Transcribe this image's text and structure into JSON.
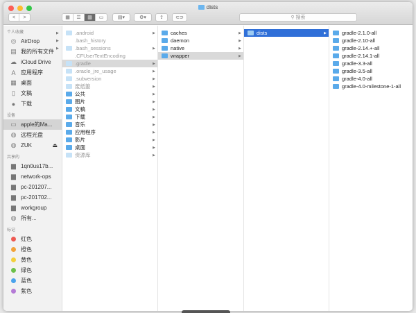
{
  "window": {
    "title": "dists",
    "search_placeholder": "搜索"
  },
  "colors": {
    "close": "#fc5f57",
    "min": "#fdbc2e",
    "max": "#33c748",
    "selection": "#2f6fd8",
    "folder": "#5aaaea"
  },
  "sidebar": {
    "favorites_header": "个人收藏",
    "favorites": [
      {
        "label": "AirDrop",
        "icon": "airdrop-icon"
      },
      {
        "label": "我的所有文件",
        "icon": "all-files-icon"
      },
      {
        "label": "iCloud Drive",
        "icon": "cloud-icon"
      },
      {
        "label": "应用程序",
        "icon": "applications-icon"
      },
      {
        "label": "桌面",
        "icon": "desktop-icon"
      },
      {
        "label": "文稿",
        "icon": "documents-icon"
      },
      {
        "label": "下载",
        "icon": "download-icon"
      }
    ],
    "devices_header": "设备",
    "devices": [
      {
        "label": "apple的Ma...",
        "icon": "laptop-icon"
      },
      {
        "label": "远程光盘",
        "icon": "disc-icon"
      },
      {
        "label": "ZUK",
        "icon": "disc-icon",
        "eject": "⏏"
      }
    ],
    "shared_header": "共享的",
    "shared": [
      {
        "label": "1qn0us17b..."
      },
      {
        "label": "network-ops"
      },
      {
        "label": "pc-201207..."
      },
      {
        "label": "pc-201702..."
      },
      {
        "label": "workgroup"
      },
      {
        "label": "所有..."
      }
    ],
    "tags_header": "标记",
    "tags": [
      {
        "label": "红色",
        "color": "#ee5a52"
      },
      {
        "label": "橙色",
        "color": "#f2a23a"
      },
      {
        "label": "黄色",
        "color": "#f3cf3c"
      },
      {
        "label": "绿色",
        "color": "#6cc049"
      },
      {
        "label": "蓝色",
        "color": "#4aa3ec"
      },
      {
        "label": "紫色",
        "color": "#b57bd6"
      }
    ]
  },
  "columns": [
    [
      {
        "name": ".android",
        "style": "pale",
        "arrow": true
      },
      {
        "name": ".bash_history",
        "style": "none"
      },
      {
        "name": ".bash_sessions",
        "style": "pale",
        "arrow": true
      },
      {
        "name": ".CFUserTextEncoding",
        "style": "none"
      },
      {
        "name": ".gradle",
        "style": "pale",
        "arrow": true,
        "state": "gray"
      },
      {
        "name": ".oracle_jre_usage",
        "style": "pale",
        "arrow": true
      },
      {
        "name": ".subversion",
        "style": "pale",
        "arrow": true
      },
      {
        "name": "废纸篓",
        "style": "pale",
        "arrow": true
      },
      {
        "name": "公共",
        "arrow": true
      },
      {
        "name": "图片",
        "arrow": true
      },
      {
        "name": "文稿",
        "arrow": true
      },
      {
        "name": "下载",
        "arrow": true
      },
      {
        "name": "音乐",
        "arrow": true
      },
      {
        "name": "应用程序",
        "arrow": true
      },
      {
        "name": "影片",
        "arrow": true
      },
      {
        "name": "桌面",
        "arrow": true
      },
      {
        "name": "资源库",
        "style": "pale",
        "arrow": true
      }
    ],
    [
      {
        "name": "caches",
        "arrow": true
      },
      {
        "name": "daemon",
        "arrow": true
      },
      {
        "name": "native",
        "arrow": true
      },
      {
        "name": "wrapper",
        "arrow": true,
        "state": "gray"
      }
    ],
    [
      {
        "name": "dists",
        "arrow": true,
        "state": "blue"
      }
    ],
    [
      {
        "name": "gradle-2.1.0-all"
      },
      {
        "name": "gradle-2.10-all"
      },
      {
        "name": "gradle-2.14.+-all"
      },
      {
        "name": "gradle-2.14.1-all"
      },
      {
        "name": "gradle-3.3-all"
      },
      {
        "name": "gradle-3.5-all"
      },
      {
        "name": "gradle-4.0-all"
      },
      {
        "name": "gradle-4.0-milestone-1-all"
      }
    ]
  ]
}
